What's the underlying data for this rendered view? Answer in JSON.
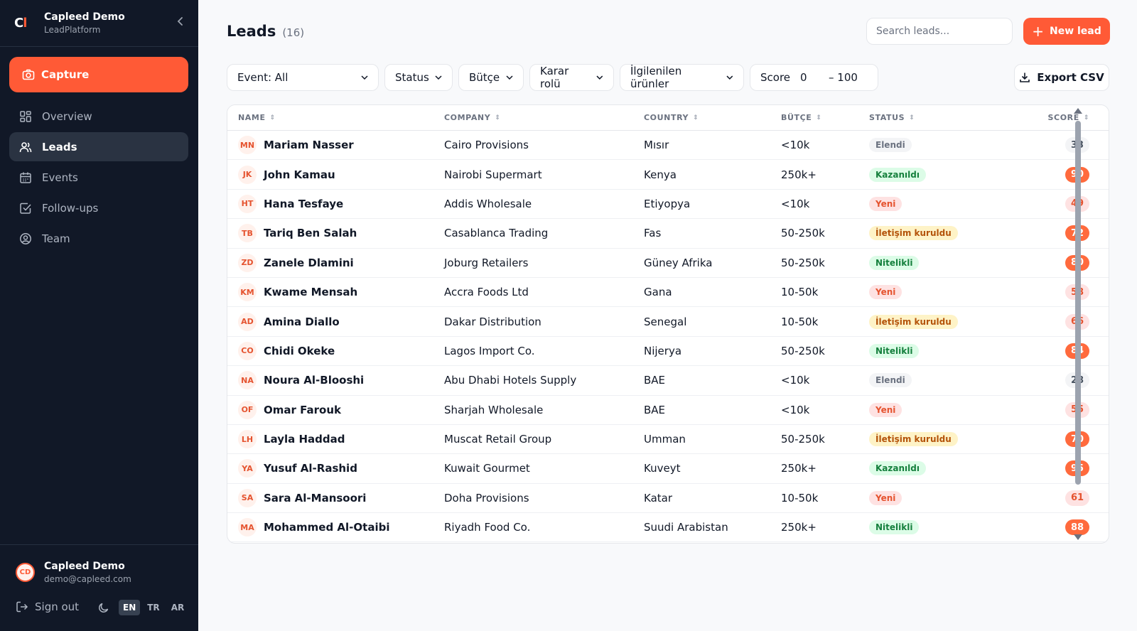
{
  "brand": {
    "logo_main": "C",
    "logo_accent": "l",
    "name": "Capleed Demo",
    "subtitle": "LeadPlatform"
  },
  "sidebar": {
    "capture_label": "Capture",
    "items": [
      {
        "label": "Overview",
        "icon": "grid-icon"
      },
      {
        "label": "Leads",
        "icon": "users-icon",
        "active": true
      },
      {
        "label": "Events",
        "icon": "calendar-icon"
      },
      {
        "label": "Follow-ups",
        "icon": "check-square-icon"
      },
      {
        "label": "Team",
        "icon": "user-circle-icon"
      }
    ],
    "user": {
      "initials": "CD",
      "name": "Capleed Demo",
      "email": "demo@capleed.com"
    },
    "signout_label": "Sign out",
    "languages": [
      "EN",
      "TR",
      "AR"
    ],
    "active_language": "EN"
  },
  "header": {
    "title": "Leads",
    "count": "(16)",
    "search_placeholder": "Search leads...",
    "new_lead_label": "New lead"
  },
  "filters": {
    "event": "Event: All",
    "status": "Status",
    "budget": "Bütçe",
    "role": "Karar rolü",
    "products": "İlgilenilen ürünler",
    "score_label": "Score",
    "score_min": "0",
    "score_max": "– 100",
    "export_label": "Export CSV"
  },
  "table": {
    "columns": [
      "NAME",
      "COMPANY",
      "COUNTRY",
      "BÜTÇE",
      "STATUS",
      "SCORE"
    ],
    "rows": [
      {
        "initials": "MN",
        "name": "Mariam Nasser",
        "company": "Cairo Provisions",
        "country": "Mısır",
        "budget": "<10k",
        "status": "Elendi",
        "score": "33"
      },
      {
        "initials": "JK",
        "name": "John Kamau",
        "company": "Nairobi Supermart",
        "country": "Kenya",
        "budget": "250k+",
        "status": "Kazanıldı",
        "score": "90"
      },
      {
        "initials": "HT",
        "name": "Hana Tesfaye",
        "company": "Addis Wholesale",
        "country": "Etiyopya",
        "budget": "<10k",
        "status": "Yeni",
        "score": "49"
      },
      {
        "initials": "TB",
        "name": "Tariq Ben Salah",
        "company": "Casablanca Trading",
        "country": "Fas",
        "budget": "50-250k",
        "status": "İletişim kuruldu",
        "score": "72"
      },
      {
        "initials": "ZD",
        "name": "Zanele Dlamini",
        "company": "Joburg Retailers",
        "country": "Güney Afrika",
        "budget": "50-250k",
        "status": "Nitelikli",
        "score": "80"
      },
      {
        "initials": "KM",
        "name": "Kwame Mensah",
        "company": "Accra Foods Ltd",
        "country": "Gana",
        "budget": "10-50k",
        "status": "Yeni",
        "score": "58"
      },
      {
        "initials": "AD",
        "name": "Amina Diallo",
        "company": "Dakar Distribution",
        "country": "Senegal",
        "budget": "10-50k",
        "status": "İletişim kuruldu",
        "score": "66"
      },
      {
        "initials": "CO",
        "name": "Chidi Okeke",
        "company": "Lagos Import Co.",
        "country": "Nijerya",
        "budget": "50-250k",
        "status": "Nitelikli",
        "score": "84"
      },
      {
        "initials": "NA",
        "name": "Noura Al-Blooshi",
        "company": "Abu Dhabi Hotels Supply",
        "country": "BAE",
        "budget": "<10k",
        "status": "Elendi",
        "score": "28"
      },
      {
        "initials": "OF",
        "name": "Omar Farouk",
        "company": "Sharjah Wholesale",
        "country": "BAE",
        "budget": "<10k",
        "status": "Yeni",
        "score": "55"
      },
      {
        "initials": "LH",
        "name": "Layla Haddad",
        "company": "Muscat Retail Group",
        "country": "Umman",
        "budget": "50-250k",
        "status": "İletişim kuruldu",
        "score": "70"
      },
      {
        "initials": "YA",
        "name": "Yusuf Al-Rashid",
        "company": "Kuwait Gourmet",
        "country": "Kuveyt",
        "budget": "250k+",
        "status": "Kazanıldı",
        "score": "95"
      },
      {
        "initials": "SA",
        "name": "Sara Al-Mansoori",
        "company": "Doha Provisions",
        "country": "Katar",
        "budget": "10-50k",
        "status": "Yeni",
        "score": "61"
      },
      {
        "initials": "MA",
        "name": "Mohammed Al-Otaibi",
        "company": "Riyadh Food Co.",
        "country": "Suudi Arabistan",
        "budget": "250k+",
        "status": "Nitelikli",
        "score": "88"
      }
    ]
  },
  "colors": {
    "accent": "#ff5a36",
    "sidebar_bg": "#111827",
    "page_bg": "#f8f9fb"
  }
}
